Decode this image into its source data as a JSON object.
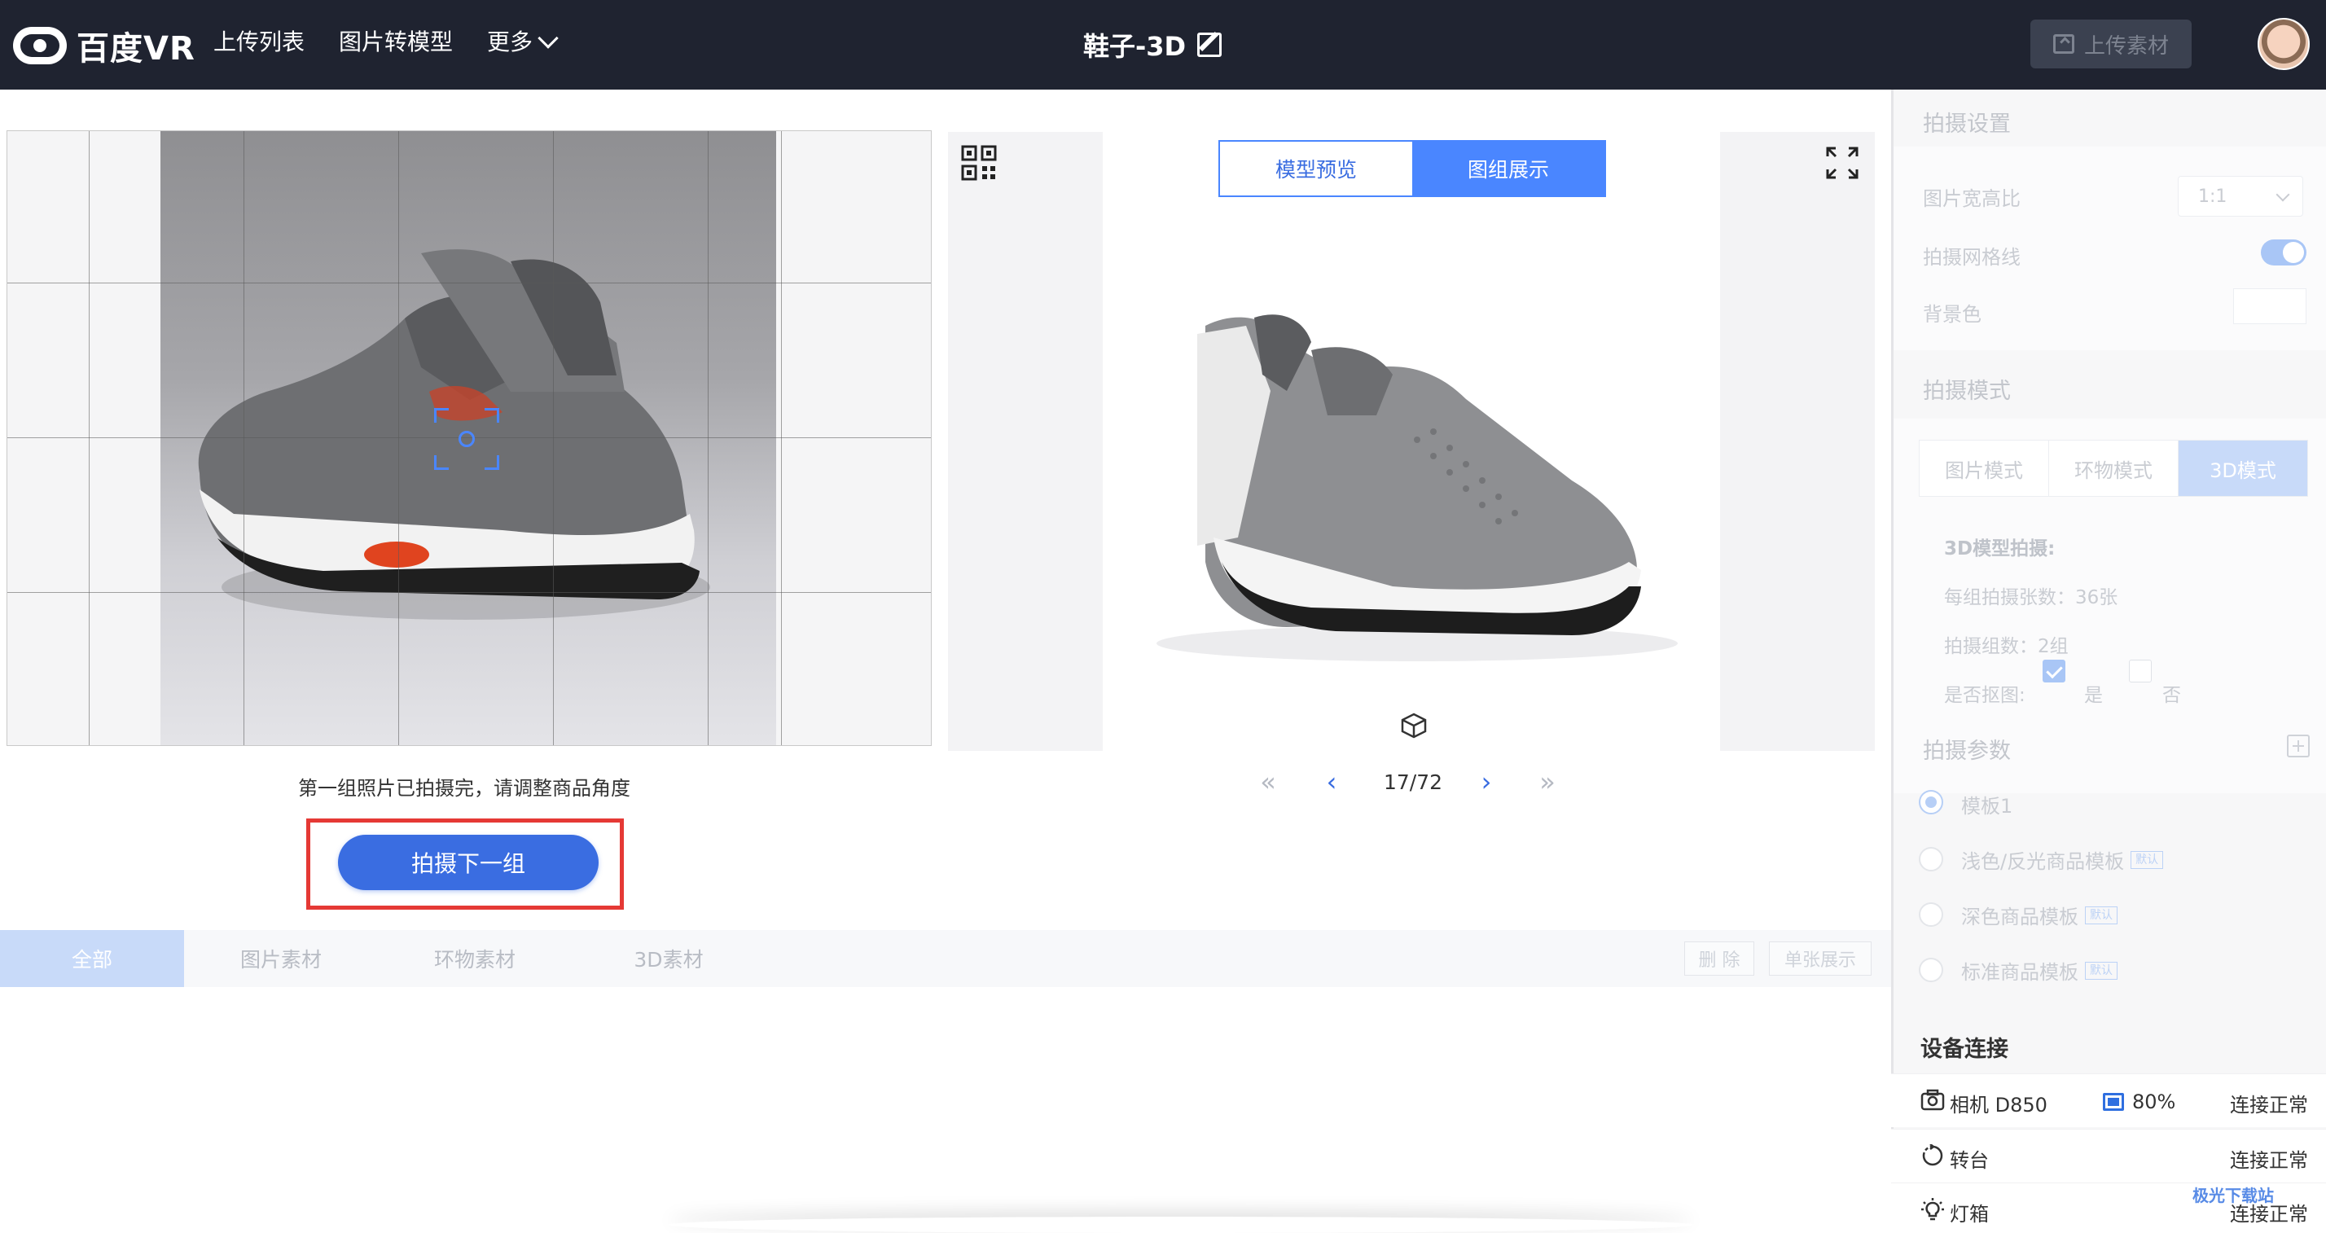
{
  "header": {
    "logo_text": "百度VR",
    "nav": [
      "上传列表",
      "图片转模型",
      "更多"
    ],
    "doc_title": "鞋子-3D",
    "upload_label": "上传素材"
  },
  "capture": {
    "hint": "第一组照片已拍摄完，请调整商品角度",
    "next_button": "拍摄下一组"
  },
  "preview": {
    "tabs": [
      "模型预览",
      "图组展示"
    ],
    "active_tab": "图组展示",
    "pager": {
      "first": "«",
      "prev": "‹",
      "label": "17/72",
      "next": "›",
      "last": "»",
      "current": 17,
      "total": 72
    }
  },
  "filter": {
    "tabs": [
      "全部",
      "图片素材",
      "环物素材",
      "3D素材"
    ],
    "active_tab": "全部",
    "delete_label": "删 除",
    "single_label": "单张展示"
  },
  "settings": {
    "capture_settings": {
      "title": "拍摄设置",
      "aspect_label": "图片宽高比",
      "aspect_value": "1:1",
      "grid_label": "拍摄网格线",
      "grid_on": true,
      "bg_label": "背景色"
    },
    "capture_mode": {
      "title": "拍摄模式",
      "tabs": [
        "图片模式",
        "环物模式",
        "3D模式"
      ],
      "active": "3D模式",
      "info_title": "3D模型拍摄:",
      "per_group": "每组拍摄张数：36张",
      "groups": "拍摄组数：2组",
      "cutout_label": "是否抠图:",
      "yes": "是",
      "no": "否"
    },
    "capture_params": {
      "title": "拍摄参数",
      "templates": [
        {
          "label": "模板1",
          "badge": ""
        },
        {
          "label": "浅色/反光商品模板",
          "badge": "默认"
        },
        {
          "label": "深色商品模板",
          "badge": "默认"
        },
        {
          "label": "标准商品模板",
          "badge": "默认"
        }
      ]
    },
    "devices": {
      "title": "设备连接",
      "camera": "相机 D850",
      "battery": "80%",
      "turntable": "转台",
      "lightbox": "灯箱",
      "status": "连接正常"
    }
  },
  "watermark": "极光下载站",
  "colors": {
    "topbar": "#1f2330",
    "accent": "#3a6de1",
    "highlight": "#e53935",
    "tab_blue": "#4a86ff"
  }
}
